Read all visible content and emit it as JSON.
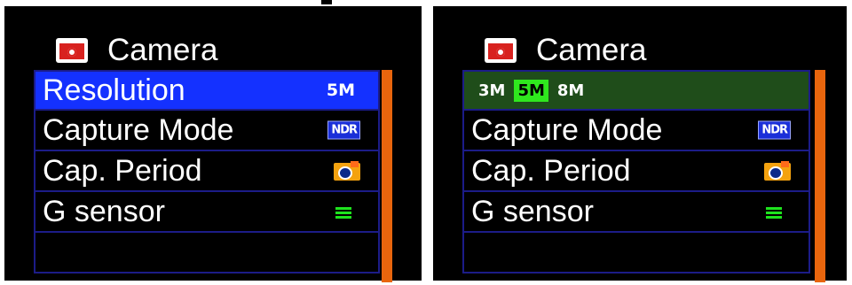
{
  "left": {
    "title": "Camera",
    "rows": [
      {
        "label": "Resolution",
        "value": "5M"
      },
      {
        "label": "Capture Mode",
        "value": "NDR"
      },
      {
        "label": "Cap. Period",
        "value": ""
      },
      {
        "label": "G sensor",
        "value": ""
      },
      {
        "label": "",
        "value": ""
      }
    ]
  },
  "right": {
    "title": "Camera",
    "resolution_options": [
      "3M",
      "5M",
      "8M"
    ],
    "selected_option": "5M",
    "rows": [
      {
        "label": "Capture Mode",
        "value": "NDR"
      },
      {
        "label": "Cap. Period",
        "value": ""
      },
      {
        "label": "G sensor",
        "value": ""
      },
      {
        "label": "",
        "value": ""
      }
    ]
  },
  "icons": {
    "title": "camera-icon",
    "capture_mode": "ndr-icon",
    "cap_period": "interval-camera-icon",
    "g_sensor": "g-sensor-level-icon"
  },
  "colors": {
    "selected_row": "#1431ff",
    "editing_row": "#1f4d1a",
    "active_option": "#2fe81e",
    "scrollbar": "#e8650d",
    "row_border": "#1c1c88"
  }
}
